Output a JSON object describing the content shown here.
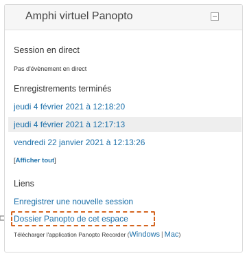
{
  "block": {
    "title": "Amphi virtuel Panopto",
    "collapse_icon": "minus-square-icon"
  },
  "live": {
    "heading": "Session en direct",
    "status": "Pas d'évènement en direct"
  },
  "recordings": {
    "heading": "Enregistrements terminés",
    "items": [
      "jeudi 4 février 2021 à 12:18:20",
      "jeudi 4 février 2021 à 12:17:13",
      "vendredi 22 janvier 2021 à 12:13:26"
    ],
    "show_all_open": "[",
    "show_all": "Afficher tout",
    "show_all_close": "]"
  },
  "links": {
    "heading": "Liens",
    "record_new": "Enregistrer une nouvelle session",
    "folder": "Dossier Panopto de cet espace",
    "download_prefix": "Télécharger l'application Panopto Recorder (",
    "windows": "Windows",
    "separator": "|",
    "mac": "Mac",
    "download_suffix": ")"
  },
  "colors": {
    "link": "#1a6ea8",
    "highlight": "#d4641f",
    "row_alt": "#eeeeee"
  }
}
